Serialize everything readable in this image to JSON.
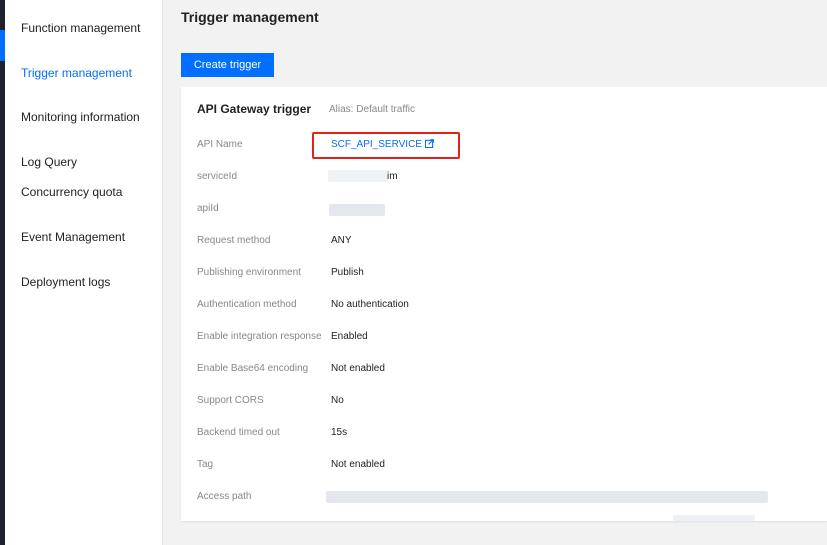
{
  "sidebar": {
    "items": [
      {
        "label": "Function management",
        "active": false
      },
      {
        "label": "Trigger management",
        "active": true
      },
      {
        "label": "Monitoring information",
        "active": false
      },
      {
        "label": "Log Query",
        "active": false
      },
      {
        "label": "Concurrency quota",
        "active": false
      },
      {
        "label": "Event Management",
        "active": false
      },
      {
        "label": "Deployment logs",
        "active": false
      }
    ]
  },
  "page": {
    "title": "Trigger management",
    "create_button": "Create trigger"
  },
  "trigger": {
    "title": "API Gateway trigger",
    "alias": "Alias: Default traffic",
    "rows": [
      {
        "label": "API Name",
        "value": "SCF_API_SERVICE"
      },
      {
        "label": "serviceId",
        "value": "im"
      },
      {
        "label": "apiId",
        "value": ""
      },
      {
        "label": "Request method",
        "value": "ANY"
      },
      {
        "label": "Publishing environment",
        "value": "Publish"
      },
      {
        "label": "Authentication method",
        "value": "No authentication"
      },
      {
        "label": "Enable integration response",
        "value": "Enabled"
      },
      {
        "label": "Enable Base64 encoding",
        "value": "Not enabled"
      },
      {
        "label": "Support CORS",
        "value": "No"
      },
      {
        "label": "Backend timed out",
        "value": "15s"
      },
      {
        "label": "Tag",
        "value": "Not enabled"
      },
      {
        "label": "Access path",
        "value": ""
      }
    ]
  },
  "colors": {
    "accent": "#006eff",
    "highlight": "#e2231a",
    "nav_dark": "#1e222d"
  }
}
